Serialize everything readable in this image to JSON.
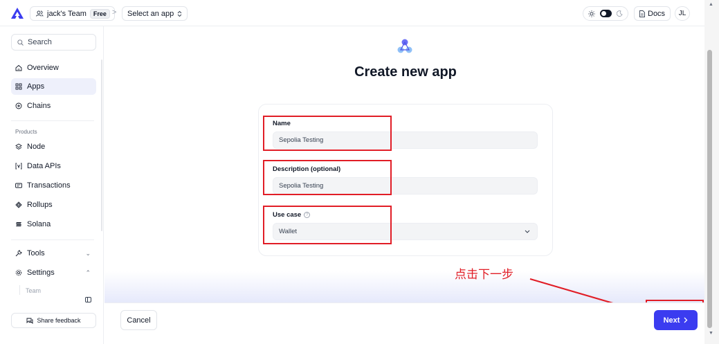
{
  "colors": {
    "accent": "#3b3cf0",
    "annotation_red": "#e11d26",
    "active_nav": "#eef0fb"
  },
  "topbar": {
    "team_name": "jack's Team",
    "plan_badge": "Free",
    "breadcrumb_separator": ">",
    "app_selector": "Select an app",
    "docs_label": "Docs",
    "avatar_initials": "JL"
  },
  "sidebar": {
    "search_placeholder": "Search",
    "items": [
      {
        "label": "Overview",
        "icon": "home-icon"
      },
      {
        "label": "Apps",
        "icon": "grid-icon"
      },
      {
        "label": "Chains",
        "icon": "plus-circle-icon"
      }
    ],
    "products_label": "Products",
    "products": [
      {
        "label": "Node",
        "icon": "node-icon"
      },
      {
        "label": "Data APIs",
        "icon": "data-icon"
      },
      {
        "label": "Transactions",
        "icon": "transactions-icon"
      },
      {
        "label": "Rollups",
        "icon": "rollups-icon"
      },
      {
        "label": "Solana",
        "icon": "solana-icon"
      }
    ],
    "tools_label": "Tools",
    "settings_label": "Settings",
    "settings_sub": "Team",
    "feedback_label": "Share feedback"
  },
  "main": {
    "title": "Create new app",
    "form": {
      "name_label": "Name",
      "name_value": "Sepolia Testing",
      "description_label": "Description (optional)",
      "description_value": "Sepolia Testing",
      "usecase_label": "Use case",
      "usecase_value": "Wallet"
    },
    "annotation": "点击下一步",
    "cancel_label": "Cancel",
    "next_label": "Next"
  }
}
